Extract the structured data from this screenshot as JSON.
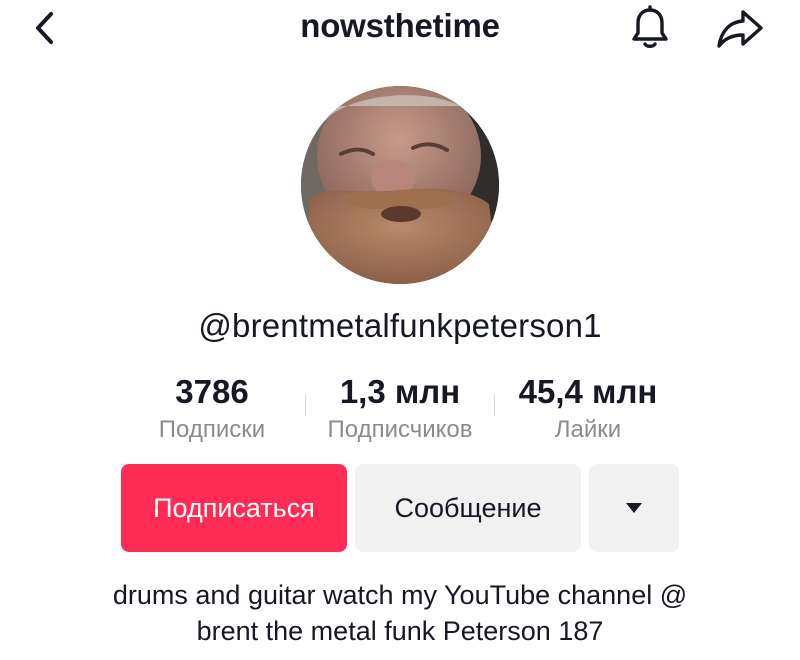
{
  "header": {
    "title": "nowsthetime",
    "back_icon": "chevron-left-icon",
    "bell_icon": "bell-icon",
    "share_icon": "share-arrow-icon"
  },
  "profile": {
    "username": "@brentmetalfunkpeterson1",
    "stats": {
      "following": {
        "value": "3786",
        "label": "Подписки"
      },
      "followers": {
        "value": "1,3 млн",
        "label": "Подписчиков"
      },
      "likes": {
        "value": "45,4 млн",
        "label": "Лайки"
      }
    },
    "bio_line1": "drums and guitar watch my YouTube channel @",
    "bio_line2": "brent the metal funk Peterson 187"
  },
  "actions": {
    "follow_label": "Подписаться",
    "message_label": "Сообщение",
    "more_icon": "caret-down-icon"
  },
  "colors": {
    "accent": "#fe2c55",
    "secondary_button": "#f1f1f2",
    "text_primary": "#161823",
    "text_secondary": "#8a8b91"
  }
}
